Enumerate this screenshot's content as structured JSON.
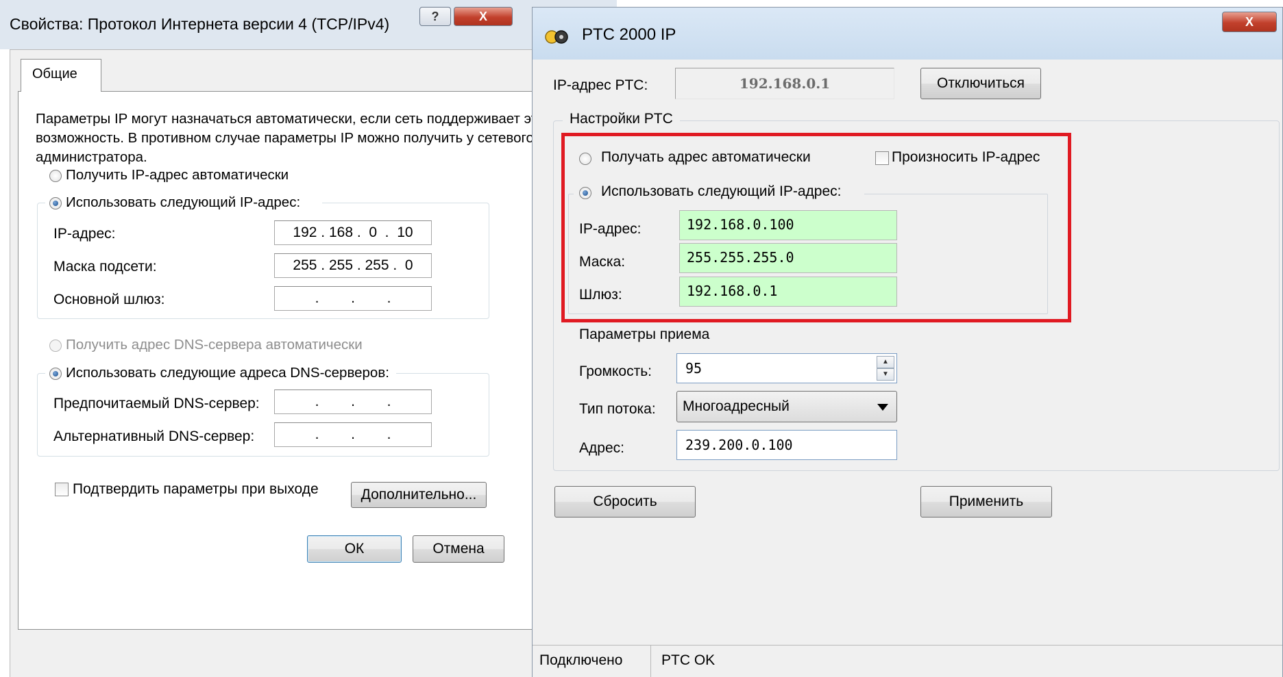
{
  "left_dialog": {
    "title": "Свойства: Протокол Интернета версии 4 (TCP/IPv4)",
    "help_button": "?",
    "close_button": "X",
    "tab_general": "Общие",
    "description": "Параметры IP могут назначаться автоматически, если сеть поддерживает эту возможность. В противном случае параметры IP можно получить у сетевого администратора.",
    "radio_auto_ip": "Получить IP-адрес автоматически",
    "radio_manual_ip": "Использовать следующий IP-адрес:",
    "label_ip": "IP-адрес:",
    "value_ip": "192 . 168 .  0  .  10",
    "label_mask": "Маска подсети:",
    "value_mask": "255 . 255 . 255 .  0",
    "label_gateway": "Основной шлюз:",
    "value_gateway": " .        .        . ",
    "radio_auto_dns": "Получить адрес DNS-сервера автоматически",
    "radio_manual_dns": "Использовать следующие адреса DNS-серверов:",
    "label_dns1": "Предпочитаемый DNS-сервер:",
    "value_dns1": " .        .        . ",
    "label_dns2": "Альтернативный DNS-сервер:",
    "value_dns2": " .        .        . ",
    "checkbox_validate": "Подтвердить параметры при выходе",
    "button_advanced": "Дополнительно...",
    "button_ok": "ОК",
    "button_cancel": "Отмена"
  },
  "right_dialog": {
    "title": "PTC 2000 IP",
    "close_button": "X",
    "label_ptc_ip": "IP-адрес PTC:",
    "value_ptc_ip": "192.168.0.1",
    "button_disconnect": "Отключиться",
    "group_settings": "Настройки PTC",
    "radio_auto": "Получать адрес автоматически",
    "checkbox_announce_ip": "Произносить IP-адрес",
    "radio_manual": "Использовать следующий IP-адрес:",
    "label_ip": "IP-адрес:",
    "value_ip": "192.168.0.100",
    "label_mask": "Маска:",
    "value_mask": "255.255.255.0",
    "label_gateway": "Шлюз:",
    "value_gateway": "192.168.0.1",
    "group_receive": "Параметры приема",
    "label_volume": "Громкость:",
    "value_volume": "95",
    "label_stream_type": "Тип потока:",
    "value_stream_type": "Многоадресный",
    "label_address": "Адрес:",
    "value_address": "239.200.0.100",
    "button_reset": "Сбросить",
    "button_apply": "Применить",
    "status_connection": "Подключено",
    "status_ptc": "PTC OK"
  },
  "colors": {
    "highlight_frame": "#e01a22",
    "field_green": "#ccffcc",
    "title_bar": "#dfe7f0"
  }
}
